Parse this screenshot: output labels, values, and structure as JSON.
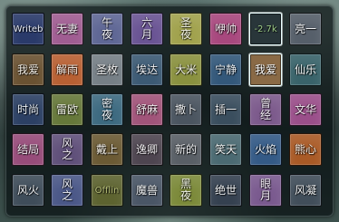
{
  "grid": {
    "rows": [
      [
        {
          "label": "Writeb",
          "color": "#2a3a6a",
          "text_color": "#e8ecf6"
        },
        {
          "label": "无妻",
          "color": "#a05d92",
          "text_color": "#f0eaf0"
        },
        {
          "label": "午夜",
          "color": "#5f6795",
          "text_color": "#f0f0f4"
        },
        {
          "label": "六月",
          "color": "#6a5494",
          "text_color": "#f0f0f4"
        },
        {
          "label": "圣夜",
          "color": "#a1a24d",
          "text_color": "#f2f2e6"
        },
        {
          "label": "咿帅",
          "color": "#a8487e",
          "text_color": "#f2e8ee"
        },
        {
          "label": "-2.7k",
          "color": "#29363a",
          "text_color": "#9fcf8a",
          "selected": true
        },
        {
          "label": "亮一",
          "color": "#565f6a",
          "text_color": "#eef0f2"
        }
      ],
      [
        {
          "label": "我爱",
          "color": "#6a5232",
          "text_color": "#f0ece4"
        },
        {
          "label": "解雨",
          "color": "#b86033",
          "text_color": "#f6ece4"
        },
        {
          "label": "圣枚",
          "color": "#767f86",
          "text_color": "#f4f4f4"
        },
        {
          "label": "埃达",
          "color": "#3c5a74",
          "text_color": "#eef0f4"
        },
        {
          "label": "大米",
          "color": "#8a913f",
          "text_color": "#f2f2e6"
        },
        {
          "label": "宁静",
          "color": "#33587a",
          "text_color": "#eaf0f6"
        },
        {
          "label": "我爱",
          "color": "#8a6a46",
          "text_color": "#ffffff",
          "selected": true
        },
        {
          "label": "仙乐",
          "color": "#39636a",
          "text_color": "#eef2f2"
        }
      ],
      [
        {
          "label": "时尚",
          "color": "#2c4064",
          "text_color": "#eaf0f6"
        },
        {
          "label": "雷欧",
          "color": "#66783a",
          "text_color": "#f0f2e6"
        },
        {
          "label": "密夜",
          "color": "#3d6a80",
          "text_color": "#eef2f6"
        },
        {
          "label": "舒麻",
          "color": "#a1547a",
          "text_color": "#f2eaee"
        },
        {
          "label": "撒卜",
          "color": "#4b5560",
          "text_color": "#eef0f2"
        },
        {
          "label": "插一",
          "color": "#3a4e5e",
          "text_color": "#eef0f2"
        },
        {
          "label": "曾经",
          "color": "#7c5a8c",
          "text_color": "#f0ecf2"
        },
        {
          "label": "文华",
          "color": "#9a4f8a",
          "text_color": "#f2eaf0"
        }
      ],
      [
        {
          "label": "结局",
          "color": "#974c7a",
          "text_color": "#f2eaf0"
        },
        {
          "label": "风之",
          "color": "#60507a",
          "text_color": "#f0ecf2"
        },
        {
          "label": "戴上",
          "color": "#6b5a34",
          "text_color": "#f0ece4"
        },
        {
          "label": "逸卿",
          "color": "#4e4550",
          "text_color": "#f0ecf0"
        },
        {
          "label": "新的",
          "color": "#595f66",
          "text_color": "#eef0f2"
        },
        {
          "label": "笑天",
          "color": "#4b6a72",
          "text_color": "#eef2f2"
        },
        {
          "label": "火焰",
          "color": "#345a86",
          "text_color": "#eaf0f6"
        },
        {
          "label": "熊心",
          "color": "#a95a26",
          "text_color": "#f6ece2"
        }
      ],
      [
        {
          "label": "风火",
          "color": "#3f4d5a",
          "text_color": "#eef0f2"
        },
        {
          "label": "风之",
          "color": "#4b5888",
          "text_color": "#eef0f6"
        },
        {
          "label": "Offlin",
          "color": "#5d6330",
          "text_color": "#b8c07a"
        },
        {
          "label": "魔兽",
          "color": "#4a5666",
          "text_color": "#eef0f2"
        },
        {
          "label": "黑夜",
          "color": "#7c8a3a",
          "text_color": "#f0f2e6"
        },
        {
          "label": "绝世",
          "color": "#354150",
          "text_color": "#eef0f2"
        },
        {
          "label": "眼月",
          "color": "#7a5a8f",
          "text_color": "#f0ecf2"
        },
        {
          "label": "风凝",
          "color": "#414e5a",
          "text_color": "#eef0f2"
        }
      ]
    ]
  }
}
